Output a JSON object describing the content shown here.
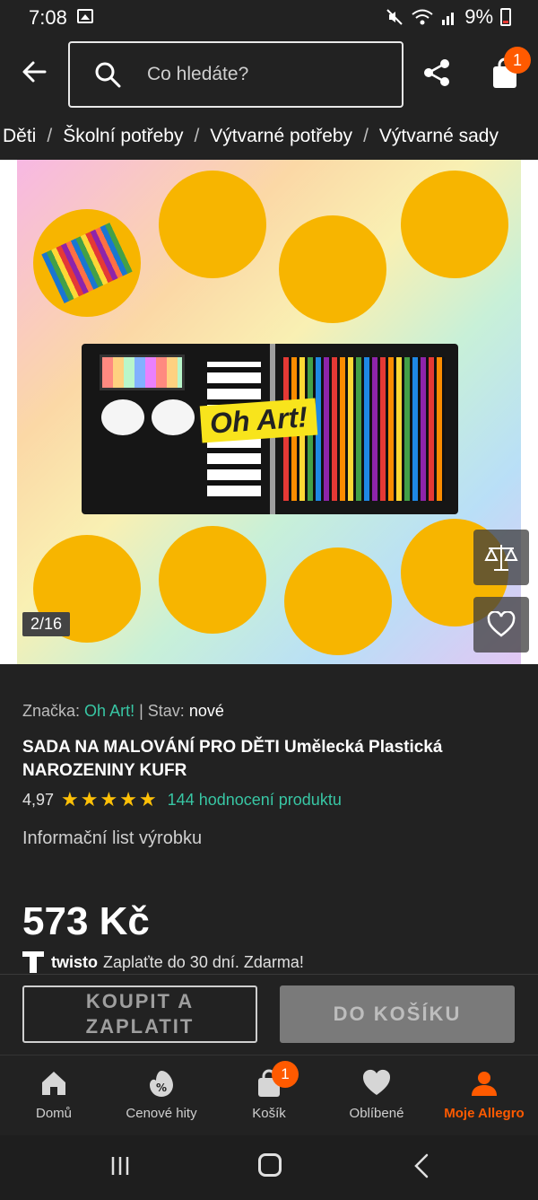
{
  "status_bar": {
    "time": "7:08",
    "battery": "9%"
  },
  "header": {
    "search_placeholder": "Co hledáte?",
    "cart_badge": "1"
  },
  "breadcrumb": [
    "Děti",
    "Školní potřeby",
    "Výtvarné potřeby",
    "Výtvarné sady"
  ],
  "gallery": {
    "counter": "2/16",
    "image_text": "Oh Art!"
  },
  "product": {
    "brand_label": "Značka:",
    "brand": "Oh Art!",
    "condition_label": "| Stav:",
    "condition": "nové",
    "title": "SADA NA MALOVÁNÍ PRO DĚTI Umělecká Plastická NAROZENINY KUFR",
    "rating": "4,97",
    "stars": "★★★★★",
    "reviews": "144 hodnocení produktu",
    "info_sheet": "Informační list výrobku",
    "price": "573 Kč",
    "twisto_brand": "twisto",
    "twisto_text": "Zaplaťte do 30 dní. Zdarma!"
  },
  "actions": {
    "buy_now": "KOUPIT A ZAPLATIT",
    "add_to_cart": "DO KOŠÍKU"
  },
  "bottom_nav": [
    {
      "label": "Domů",
      "icon": "home-icon"
    },
    {
      "label": "Cenové hity",
      "icon": "discount-icon"
    },
    {
      "label": "Košík",
      "icon": "bag-icon",
      "badge": "1"
    },
    {
      "label": "Oblíbené",
      "icon": "heart-icon"
    },
    {
      "label": "Moje Allegro",
      "icon": "user-icon",
      "active": true
    }
  ],
  "colors": {
    "accent": "#ff5a00",
    "link": "#38c6a4",
    "star": "#ffc107",
    "background": "#222222"
  }
}
